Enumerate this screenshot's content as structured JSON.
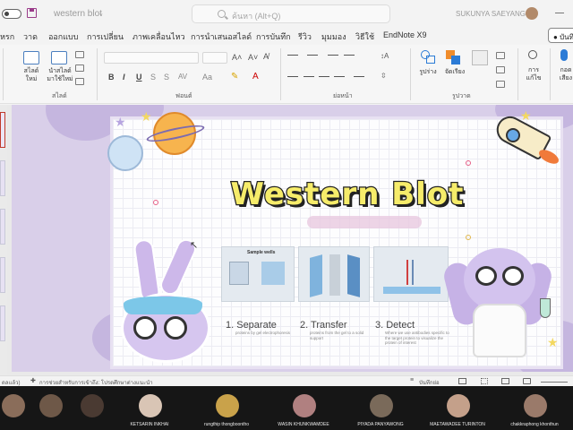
{
  "titlebar": {
    "doc_title": "western blot",
    "search_placeholder": "ค้นหา (Alt+Q)",
    "user_name": "SUKUNYA SAEYANG"
  },
  "ribbon_tabs": [
    "หรก",
    "วาด",
    "ออกแบบ",
    "การเปลี่ยน",
    "ภาพเคลื่อนไหว",
    "การนำเสนอสไลด์",
    "การบันทึก",
    "รีวิว",
    "มุมมอง",
    "วิธีใช้",
    "EndNote X9"
  ],
  "share_label": "บันทึ",
  "ribbon": {
    "new_slide": "สไลด์\nใหม่",
    "reuse_slide": "นำสไลด์\nมาใช้ใหม่",
    "group_slides": "สไลด์",
    "group_font": "ฟอนต์",
    "group_paragraph": "ย่อหน้า",
    "group_drawing": "รูปวาด",
    "shapes": "รูปร่าง",
    "arrange": "จัดเรียง",
    "edit": "การ\nแก้ไข",
    "dictate": "กอด\nเสียง",
    "bold": "B",
    "italic": "I",
    "underline": "U"
  },
  "slide": {
    "title": "Western Blot",
    "figure1_caption": "Sample wells",
    "steps": [
      {
        "label": "1. Separate",
        "desc": "proteins by gel electrophoresis"
      },
      {
        "label": "2. Transfer",
        "desc": "proteins from the gel to a solid support"
      },
      {
        "label": "3. Detect",
        "desc": "Where we use antibodies specific to the target protein to visualize the protein of interest"
      }
    ]
  },
  "statusbar": {
    "left": "ดลแล้ว)",
    "accessibility": "การช่วยสำหรับการเข้าถึง: โปรดศึกษาต่างแนะนำ",
    "notes": "บันทึกย่อ"
  },
  "participants": [
    {
      "name": "",
      "color": "#8a6d5a"
    },
    {
      "name": "",
      "color": "#6e5848"
    },
    {
      "name": "",
      "color": "#4a3a32"
    },
    {
      "name": "KETSARIN INKHAI",
      "color": "#d9c5b5"
    },
    {
      "name": "rungthip thongboontho",
      "color": "#c9a24a"
    },
    {
      "name": "WASIN KHUNKWAMDEE",
      "color": "#b08080"
    },
    {
      "name": "PIYADA PANYAWONG",
      "color": "#7a6a5a"
    },
    {
      "name": "MAETAWADEE TURINTON",
      "color": "#c4a08a"
    },
    {
      "name": "chakkraphong khonthun",
      "color": "#9a7a6a"
    }
  ]
}
